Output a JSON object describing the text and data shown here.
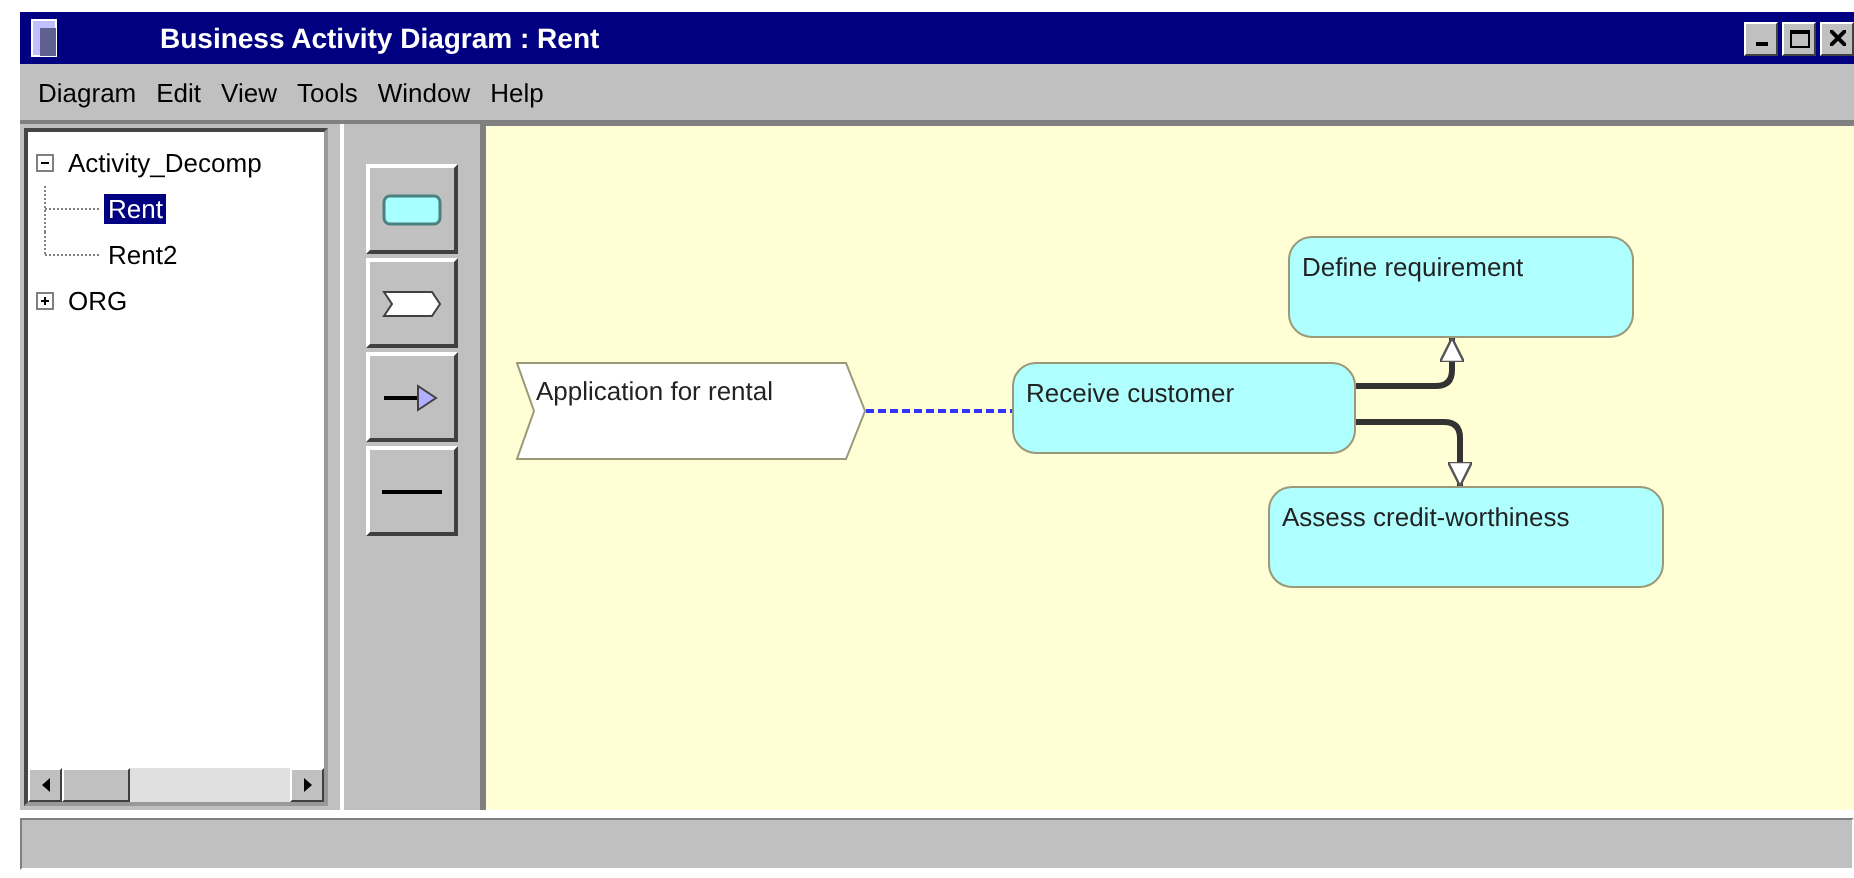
{
  "window": {
    "title": "Business Activity Diagram : Rent"
  },
  "menu": [
    "Diagram",
    "Edit",
    "View",
    "Tools",
    "Window",
    "Help"
  ],
  "tree": [
    {
      "label": "Activity_Decomp",
      "expanded": true,
      "selected": false,
      "children": [
        {
          "label": "Rent",
          "selected": true
        },
        {
          "label": "Rent2",
          "selected": false
        }
      ]
    },
    {
      "label": "ORG",
      "expanded": false,
      "selected": false
    }
  ],
  "palette": [
    {
      "kind": "activity"
    },
    {
      "kind": "event"
    },
    {
      "kind": "flow"
    },
    {
      "kind": "line"
    }
  ],
  "diagram": {
    "nodes": [
      {
        "kind": "event",
        "label": "Application for rental"
      },
      {
        "kind": "activity",
        "label": "Receive customer"
      },
      {
        "kind": "activity",
        "label": "Define requirement"
      },
      {
        "kind": "activity",
        "label": "Assess credit-worthiness"
      }
    ],
    "connectors": [
      {
        "kind": "dashed"
      },
      {
        "kind": "arrow"
      },
      {
        "kind": "arrow"
      }
    ]
  }
}
